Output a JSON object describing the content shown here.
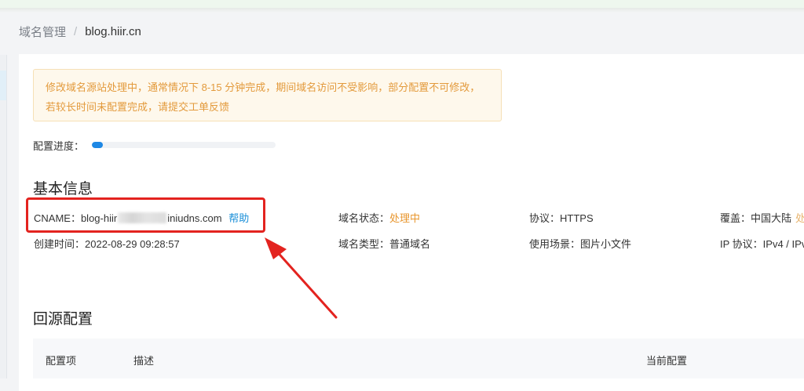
{
  "breadcrumb": {
    "parent": "域名管理",
    "separator": "/",
    "current": "blog.hiir.cn"
  },
  "notice": {
    "line1": "修改域名源站处理中，通常情况下 8-15 分钟完成，期间域名访问不受影响，部分配置不可修改，",
    "line2": "若较长时间未配置完成，请提交工单反馈"
  },
  "progress": {
    "label": "配置进度：",
    "value_percent": 6
  },
  "basic_info": {
    "title": "基本信息",
    "cname": {
      "label": "CNAME：",
      "value_start": "blog-hiir",
      "value_end": "iniudns.com",
      "help": "帮助"
    },
    "created": {
      "label": "创建时间：",
      "value": "2022-08-29 09:28:57"
    },
    "domain_status": {
      "label": "域名状态：",
      "value": "处理中"
    },
    "domain_type": {
      "label": "域名类型：",
      "value": "普通域名"
    },
    "protocol": {
      "label": "协议：",
      "value": "HTTPS"
    },
    "scenario": {
      "label": "使用场景：",
      "value": "图片小文件"
    },
    "coverage": {
      "label": "覆盖：",
      "value": "中国大陆",
      "extra": "处"
    },
    "ip_protocol": {
      "label": "IP 协议：",
      "value": "IPv4 / IPv"
    }
  },
  "origin": {
    "title": "回源配置",
    "columns": [
      "配置项",
      "描述",
      "当前配置"
    ]
  },
  "colors": {
    "accent": "#1e88e5",
    "warning": "#e8962e",
    "annotation": "#e3231f"
  }
}
